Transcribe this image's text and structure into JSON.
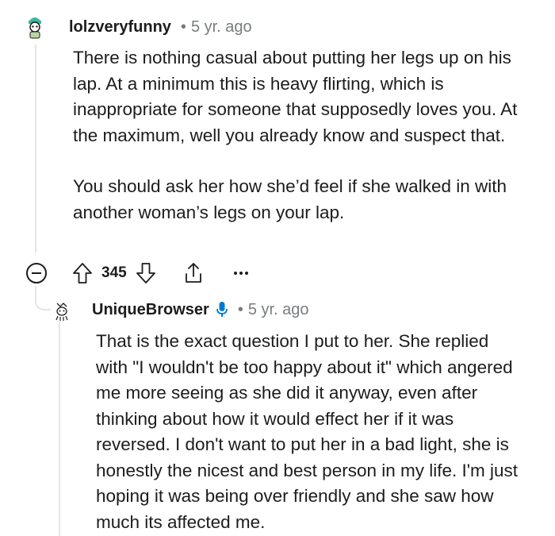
{
  "comments": [
    {
      "username": "lolzveryfunny",
      "separator": "•",
      "age": "5 yr. ago",
      "paragraphs": [
        "There is nothing casual about putting her legs up on his lap. At a minimum this is heavy flirting, which is inappropriate for someone that supposedly loves you. At the maximum, well you already know and suspect that.",
        "You should ask her how she’d feel if she walked in with another woman’s legs on your lap."
      ],
      "score": "345",
      "icons": {
        "upvote": "arrow-up-icon",
        "downvote": "arrow-down-icon",
        "share": "share-icon",
        "more": "more-options-icon",
        "collapse": "collapse-icon"
      }
    },
    {
      "username": "UniqueBrowser",
      "badge_icon": "microphone-icon",
      "separator": "•",
      "age": "5 yr. ago",
      "paragraphs": [
        "That is the exact question I put to her. She replied with \"I wouldn't be too happy about it\" which angered me more seeing as she did it anyway, even after thinking about how it would effect her if it was reversed. I don't want to put her in a bad light, she is honestly the nicest and best person in my life. I'm just hoping it was being over friendly and she saw how much its affected me."
      ]
    }
  ],
  "colors": {
    "text": "#1c1c1c",
    "meta": "#787c7e",
    "thread_line": "#e5e5e5",
    "badge": "#0079d3"
  }
}
